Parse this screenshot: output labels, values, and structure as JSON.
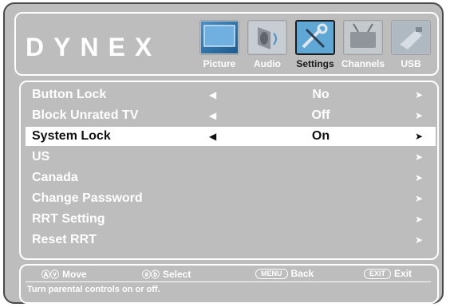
{
  "brand": {
    "logo_text": "DYNEX"
  },
  "tabs": [
    {
      "label": "Picture",
      "icon": "picture-icon",
      "active": false
    },
    {
      "label": "Audio",
      "icon": "audio-icon",
      "active": false
    },
    {
      "label": "Settings",
      "icon": "settings-icon",
      "active": true
    },
    {
      "label": "Channels",
      "icon": "channels-icon",
      "active": false
    },
    {
      "label": "USB",
      "icon": "usb-icon",
      "active": false
    }
  ],
  "menu": {
    "items": [
      {
        "label": "Button Lock",
        "value": "No",
        "has_left_arrow": true
      },
      {
        "label": "Block Unrated TV",
        "value": "Off",
        "has_left_arrow": true
      },
      {
        "label": "System Lock",
        "value": "On",
        "has_left_arrow": true,
        "selected": true
      },
      {
        "label": "US",
        "value": "",
        "has_left_arrow": false
      },
      {
        "label": "Canada",
        "value": "",
        "has_left_arrow": false
      },
      {
        "label": "Change Password",
        "value": "",
        "has_left_arrow": false
      },
      {
        "label": "RRT Setting",
        "value": "",
        "has_left_arrow": false
      },
      {
        "label": "Reset RRT",
        "value": "",
        "has_left_arrow": false
      }
    ],
    "left_arrow_glyph": "◀",
    "right_arrow_glyph": "➤"
  },
  "footer": {
    "keys": [
      {
        "icon": "up-down-arrows-icon",
        "glyph": "Ⓐⓥ",
        "label": "Move"
      },
      {
        "icon": "left-right-arrows-icon",
        "glyph": "ⓐⓑ",
        "label": "Select"
      },
      {
        "icon": "menu-key-icon",
        "pill": "MENU",
        "label": "Back"
      },
      {
        "icon": "exit-key-icon",
        "pill": "EXIT",
        "label": "Exit"
      }
    ],
    "help_text": "Turn parental controls on or off."
  },
  "colors": {
    "panel_bg": "#bdbdbd",
    "text": "#ffffff",
    "selected_row_bg": "#ffffff",
    "selected_text": "#111111"
  }
}
